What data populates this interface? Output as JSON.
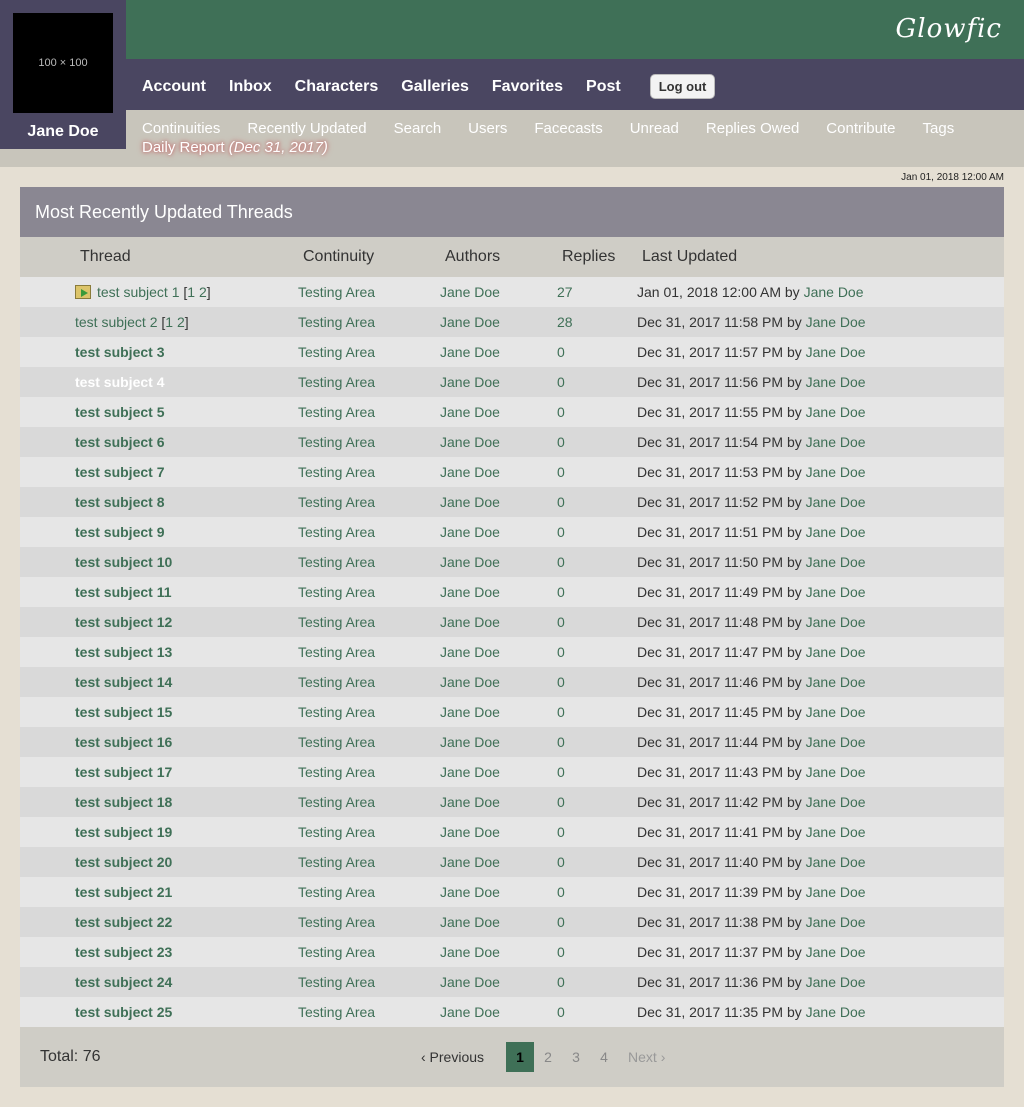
{
  "brand": "Glowfic",
  "user": {
    "avatar_label": "100 × 100",
    "name": "Jane Doe"
  },
  "main_nav": [
    "Account",
    "Inbox",
    "Characters",
    "Galleries",
    "Favorites",
    "Post"
  ],
  "logout_label": "Log out",
  "sub_nav": [
    "Continuities",
    "Recently Updated",
    "Search",
    "Users",
    "Facecasts",
    "Unread",
    "Replies Owed",
    "Contribute",
    "Tags"
  ],
  "daily_report": {
    "label": "Daily Report",
    "date": "(Dec 31, 2017)"
  },
  "current_time": "Jan 01, 2018 12:00 AM",
  "table": {
    "title": "Most Recently Updated Threads",
    "headers": [
      "Thread",
      "Continuity",
      "Authors",
      "Replies",
      "Last Updated"
    ],
    "by_label": "by",
    "rows": [
      {
        "subject": "test subject 1",
        "pages": [
          "1",
          "2"
        ],
        "continuity": "Testing Area",
        "author": "Jane Doe",
        "replies": "27",
        "updated": "Jan 01, 2018 12:00 AM",
        "updated_by": "Jane Doe",
        "style": "unread-icon"
      },
      {
        "subject": "test subject 2",
        "pages": [
          "1",
          "2"
        ],
        "continuity": "Testing Area",
        "author": "Jane Doe",
        "replies": "28",
        "updated": "Dec 31, 2017 11:58 PM",
        "updated_by": "Jane Doe",
        "style": "plain"
      },
      {
        "subject": "test subject 3",
        "pages": [],
        "continuity": "Testing Area",
        "author": "Jane Doe",
        "replies": "0",
        "updated": "Dec 31, 2017 11:57 PM",
        "updated_by": "Jane Doe",
        "style": "bold"
      },
      {
        "subject": "test subject 4",
        "pages": [],
        "continuity": "Testing Area",
        "author": "Jane Doe",
        "replies": "0",
        "updated": "Dec 31, 2017 11:56 PM",
        "updated_by": "Jane Doe",
        "style": "highlight"
      },
      {
        "subject": "test subject 5",
        "pages": [],
        "continuity": "Testing Area",
        "author": "Jane Doe",
        "replies": "0",
        "updated": "Dec 31, 2017 11:55 PM",
        "updated_by": "Jane Doe",
        "style": "bold"
      },
      {
        "subject": "test subject 6",
        "pages": [],
        "continuity": "Testing Area",
        "author": "Jane Doe",
        "replies": "0",
        "updated": "Dec 31, 2017 11:54 PM",
        "updated_by": "Jane Doe",
        "style": "bold"
      },
      {
        "subject": "test subject 7",
        "pages": [],
        "continuity": "Testing Area",
        "author": "Jane Doe",
        "replies": "0",
        "updated": "Dec 31, 2017 11:53 PM",
        "updated_by": "Jane Doe",
        "style": "bold"
      },
      {
        "subject": "test subject 8",
        "pages": [],
        "continuity": "Testing Area",
        "author": "Jane Doe",
        "replies": "0",
        "updated": "Dec 31, 2017 11:52 PM",
        "updated_by": "Jane Doe",
        "style": "bold"
      },
      {
        "subject": "test subject 9",
        "pages": [],
        "continuity": "Testing Area",
        "author": "Jane Doe",
        "replies": "0",
        "updated": "Dec 31, 2017 11:51 PM",
        "updated_by": "Jane Doe",
        "style": "bold"
      },
      {
        "subject": "test subject 10",
        "pages": [],
        "continuity": "Testing Area",
        "author": "Jane Doe",
        "replies": "0",
        "updated": "Dec 31, 2017 11:50 PM",
        "updated_by": "Jane Doe",
        "style": "bold"
      },
      {
        "subject": "test subject 11",
        "pages": [],
        "continuity": "Testing Area",
        "author": "Jane Doe",
        "replies": "0",
        "updated": "Dec 31, 2017 11:49 PM",
        "updated_by": "Jane Doe",
        "style": "bold"
      },
      {
        "subject": "test subject 12",
        "pages": [],
        "continuity": "Testing Area",
        "author": "Jane Doe",
        "replies": "0",
        "updated": "Dec 31, 2017 11:48 PM",
        "updated_by": "Jane Doe",
        "style": "bold"
      },
      {
        "subject": "test subject 13",
        "pages": [],
        "continuity": "Testing Area",
        "author": "Jane Doe",
        "replies": "0",
        "updated": "Dec 31, 2017 11:47 PM",
        "updated_by": "Jane Doe",
        "style": "bold"
      },
      {
        "subject": "test subject 14",
        "pages": [],
        "continuity": "Testing Area",
        "author": "Jane Doe",
        "replies": "0",
        "updated": "Dec 31, 2017 11:46 PM",
        "updated_by": "Jane Doe",
        "style": "bold"
      },
      {
        "subject": "test subject 15",
        "pages": [],
        "continuity": "Testing Area",
        "author": "Jane Doe",
        "replies": "0",
        "updated": "Dec 31, 2017 11:45 PM",
        "updated_by": "Jane Doe",
        "style": "bold"
      },
      {
        "subject": "test subject 16",
        "pages": [],
        "continuity": "Testing Area",
        "author": "Jane Doe",
        "replies": "0",
        "updated": "Dec 31, 2017 11:44 PM",
        "updated_by": "Jane Doe",
        "style": "bold"
      },
      {
        "subject": "test subject 17",
        "pages": [],
        "continuity": "Testing Area",
        "author": "Jane Doe",
        "replies": "0",
        "updated": "Dec 31, 2017 11:43 PM",
        "updated_by": "Jane Doe",
        "style": "bold"
      },
      {
        "subject": "test subject 18",
        "pages": [],
        "continuity": "Testing Area",
        "author": "Jane Doe",
        "replies": "0",
        "updated": "Dec 31, 2017 11:42 PM",
        "updated_by": "Jane Doe",
        "style": "bold"
      },
      {
        "subject": "test subject 19",
        "pages": [],
        "continuity": "Testing Area",
        "author": "Jane Doe",
        "replies": "0",
        "updated": "Dec 31, 2017 11:41 PM",
        "updated_by": "Jane Doe",
        "style": "bold"
      },
      {
        "subject": "test subject 20",
        "pages": [],
        "continuity": "Testing Area",
        "author": "Jane Doe",
        "replies": "0",
        "updated": "Dec 31, 2017 11:40 PM",
        "updated_by": "Jane Doe",
        "style": "bold"
      },
      {
        "subject": "test subject 21",
        "pages": [],
        "continuity": "Testing Area",
        "author": "Jane Doe",
        "replies": "0",
        "updated": "Dec 31, 2017 11:39 PM",
        "updated_by": "Jane Doe",
        "style": "bold"
      },
      {
        "subject": "test subject 22",
        "pages": [],
        "continuity": "Testing Area",
        "author": "Jane Doe",
        "replies": "0",
        "updated": "Dec 31, 2017 11:38 PM",
        "updated_by": "Jane Doe",
        "style": "bold"
      },
      {
        "subject": "test subject 23",
        "pages": [],
        "continuity": "Testing Area",
        "author": "Jane Doe",
        "replies": "0",
        "updated": "Dec 31, 2017 11:37 PM",
        "updated_by": "Jane Doe",
        "style": "bold"
      },
      {
        "subject": "test subject 24",
        "pages": [],
        "continuity": "Testing Area",
        "author": "Jane Doe",
        "replies": "0",
        "updated": "Dec 31, 2017 11:36 PM",
        "updated_by": "Jane Doe",
        "style": "bold"
      },
      {
        "subject": "test subject 25",
        "pages": [],
        "continuity": "Testing Area",
        "author": "Jane Doe",
        "replies": "0",
        "updated": "Dec 31, 2017 11:35 PM",
        "updated_by": "Jane Doe",
        "style": "bold"
      }
    ]
  },
  "footer": {
    "total_label": "Total: 76",
    "prev_label": "‹ Previous",
    "next_label": "Next ›",
    "pages": [
      "1",
      "2",
      "3",
      "4"
    ],
    "current_page": "1"
  },
  "colors": {
    "brand_green": "#3f7057",
    "nav_purple": "#4a4661",
    "background": "#e5dfd3"
  },
  "icons": {
    "unread": "unread-thread-icon"
  }
}
